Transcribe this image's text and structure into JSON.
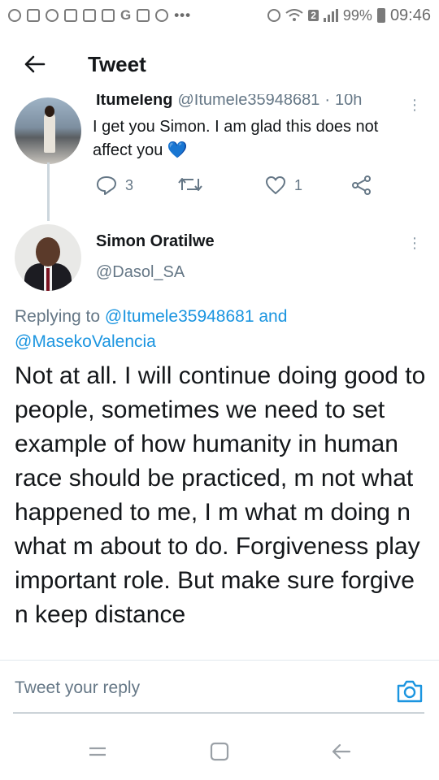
{
  "status_bar": {
    "battery_percent": "99%",
    "time": "09:46",
    "notification_badge": "2",
    "icons": [
      "facebook-icon",
      "messenger-icon",
      "viber-icon",
      "checkbox-icon",
      "gmail-icon",
      "gmail-icon",
      "google-icon",
      "gallery-icon",
      "vpn-icon",
      "more-dots-icon",
      "alarm-icon",
      "wifi-icon",
      "signal-icon",
      "battery-icon"
    ]
  },
  "header": {
    "title": "Tweet",
    "back_icon": "arrow-left-icon"
  },
  "previous_tweet": {
    "name": "Itumeleng",
    "handle": "@Itumele35948681",
    "separator": "·",
    "time": "10h",
    "text": "I get you Simon. I am glad this does not affect you",
    "emoji": "💙",
    "actions": {
      "reply_count": "3",
      "retweet_count": "",
      "like_count": "1"
    }
  },
  "main_tweet": {
    "name": "Simon Oratilwe",
    "handle": "@Dasol_SA",
    "replying_prefix": "Replying to ",
    "mention_1": "@Itumele35948681",
    "conjunction": " and",
    "mention_2": "@MasekoValencia",
    "text": "Not at all. I will continue doing good to people, sometimes we need to set example of how humanity in human race should be practiced, m not what happened to me, I m what m doing n what m about to do. Forgiveness play important role. But make sure forgive n keep distance"
  },
  "reply_bar": {
    "placeholder": "Tweet your reply",
    "camera_icon": "camera-icon"
  },
  "colors": {
    "accent": "#1b95e0",
    "secondary_text": "#657786",
    "primary_text": "#14171a",
    "heart_emoji": "#1d8ff0"
  }
}
